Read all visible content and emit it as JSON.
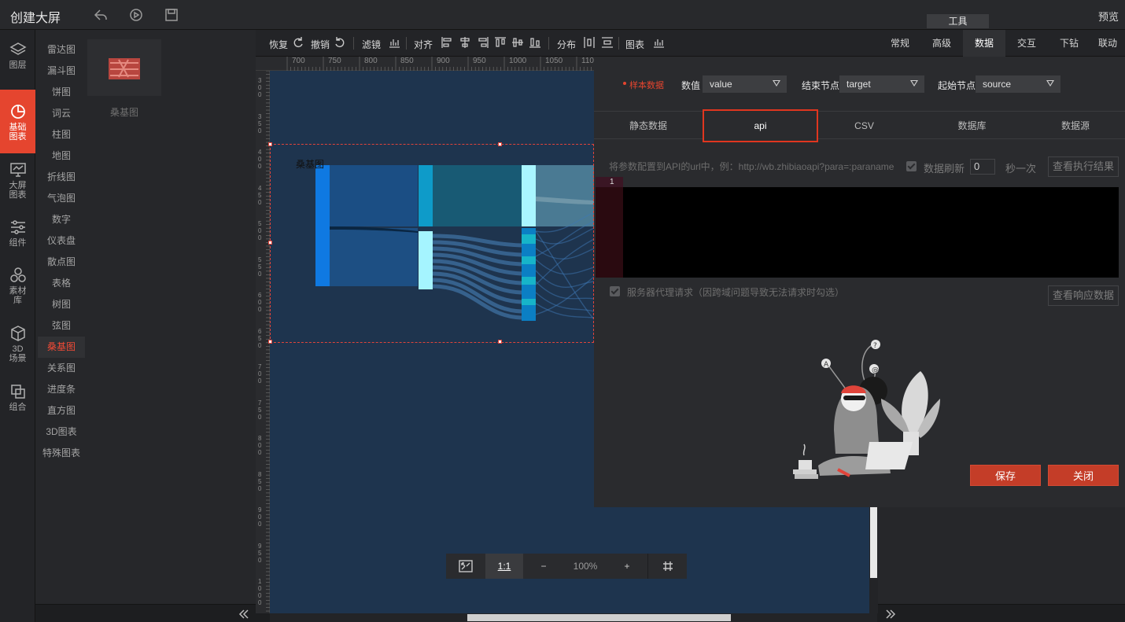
{
  "app": {
    "title": "创建大屏",
    "preview": "预览"
  },
  "nav": [
    {
      "name": "layers",
      "label": "图层",
      "icon": "layers-icon"
    },
    {
      "name": "basic-charts",
      "label": "基础\n图表",
      "icon": "pie-chart-icon",
      "active": true
    },
    {
      "name": "screen-charts",
      "label": "大屏\n图表",
      "icon": "monitor-chart-icon"
    },
    {
      "name": "components",
      "label": "组件",
      "icon": "sliders-icon"
    },
    {
      "name": "assets",
      "label": "素材\n库",
      "icon": "hexagons-icon"
    },
    {
      "name": "3d-scene",
      "label": "3D\n场景",
      "icon": "cube-icon"
    },
    {
      "name": "group",
      "label": "组合",
      "icon": "group-icon"
    }
  ],
  "chart_types": [
    "雷达图",
    "漏斗图",
    "饼图",
    "词云",
    "柱图",
    "地图",
    "折线图",
    "气泡图",
    "数字",
    "仪表盘",
    "散点图",
    "表格",
    "树图",
    "弦图",
    "桑基图",
    "关系图",
    "进度条",
    "直方图",
    "3D图表",
    "特殊图表"
  ],
  "active_chart_type": "桑基图",
  "thumbnail_label": "桑基图",
  "toolbar": {
    "redo": "恢复",
    "undo": "撤销",
    "filter": "滤镜",
    "align": "对齐",
    "distribute": "分布",
    "chart": "图表",
    "tool_tab": "工具"
  },
  "right_tabs": [
    "常规",
    "高级",
    "数据",
    "交互",
    "下钻",
    "联动"
  ],
  "active_right_tab": "数据",
  "ruler_top": [
    "700",
    "750",
    "800",
    "850",
    "900",
    "950",
    "1000",
    "1050",
    "1100"
  ],
  "ruler_left": [
    "300",
    "350",
    "400",
    "450",
    "500",
    "550",
    "600",
    "650",
    "700",
    "750",
    "800",
    "850",
    "900",
    "950",
    "1000"
  ],
  "canvas": {
    "sankey_title": "桑基图"
  },
  "zoom": {
    "ratio": "1:1",
    "minus": "−",
    "percent": "100%",
    "plus": "+"
  },
  "dialog": {
    "sample_data": "样本数据",
    "value_label": "数值",
    "value": "value",
    "target_label": "结束节点",
    "target": "target",
    "source_label": "起始节点",
    "source": "source",
    "source_tabs": [
      "静态数据",
      "api",
      "CSV",
      "数据库",
      "数据源"
    ],
    "active_source_tab": "api",
    "api_hint": "将参数配置到API的url中，例：http://wb.zhibiaoapi?para=:paraname",
    "refresh_label": "数据刷新",
    "refresh_value": "0",
    "refresh_unit": "秒一次",
    "view_result": "查看执行结果",
    "line_number": "1",
    "proxy_label": "服务器代理请求（因跨域问题导致无法请求时勾选）",
    "view_response": "查看响应数据",
    "save": "保存",
    "close": "关闭"
  },
  "colors": {
    "accent": "#e5452f",
    "canvas_bg": "#1e344e",
    "panel_bg": "#2a2b2e"
  }
}
